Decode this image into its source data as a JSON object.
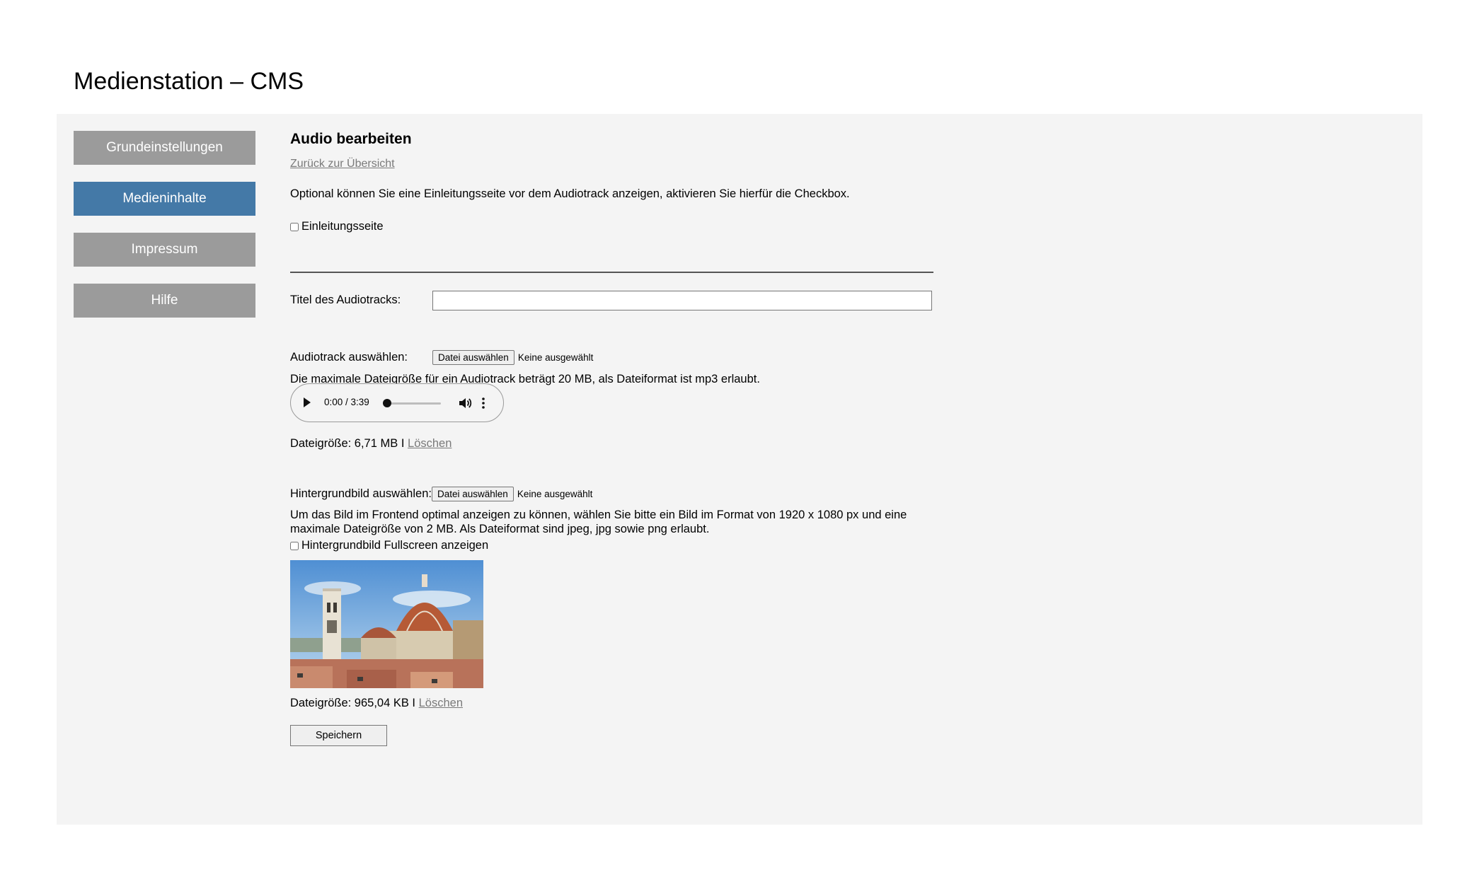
{
  "app": {
    "title": "Medienstation – CMS"
  },
  "nav": {
    "items": [
      {
        "label": "Grundeinstellungen"
      },
      {
        "label": "Medieninhalte"
      },
      {
        "label": "Impressum"
      },
      {
        "label": "Hilfe"
      }
    ],
    "active": "Medieninhalte"
  },
  "content": {
    "heading": "Audio bearbeiten",
    "back_link": "Zurück zur Übersicht",
    "intro_text": "Optional können Sie eine Einleitungsseite vor dem Audiotrack anzeigen, aktivieren Sie hierfür die Checkbox.",
    "intro_checkbox": {
      "label": "Einleitungsseite",
      "checked": false
    },
    "title_field": {
      "label": "Titel des Audiotracks:",
      "value": ""
    },
    "audio_select": {
      "label": "Audiotrack auswählen:",
      "button": "Datei auswählen",
      "status": "Keine ausgewählt",
      "hint": "Die maximale Dateigröße für ein Audiotrack beträgt 20 MB, als Dateiformat ist mp3 erlaubt."
    },
    "player": {
      "time": "0:00 / 3:39",
      "progress": 0
    },
    "audio_file": {
      "size_text": "Dateigröße: 6,71 MB I",
      "delete": "Löschen"
    },
    "background_select": {
      "label": "Hintergrundbild auswählen:",
      "button": "Datei auswählen",
      "status": "Keine ausgewählt",
      "hint": "Um das Bild im Frontend optimal anzeigen zu können, wählen Sie bitte ein Bild im Format von 1920 x 1080 px und eine maximale Dateigröße von 2 MB. Als Dateiformat sind jpeg, jpg sowie png erlaubt."
    },
    "fullscreen_checkbox": {
      "label": "Hintergrundbild Fullscreen anzeigen",
      "checked": false
    },
    "image_file": {
      "size_text": "Dateigröße: 965,04 KB I",
      "delete": "Löschen"
    },
    "save_button": "Speichern"
  }
}
